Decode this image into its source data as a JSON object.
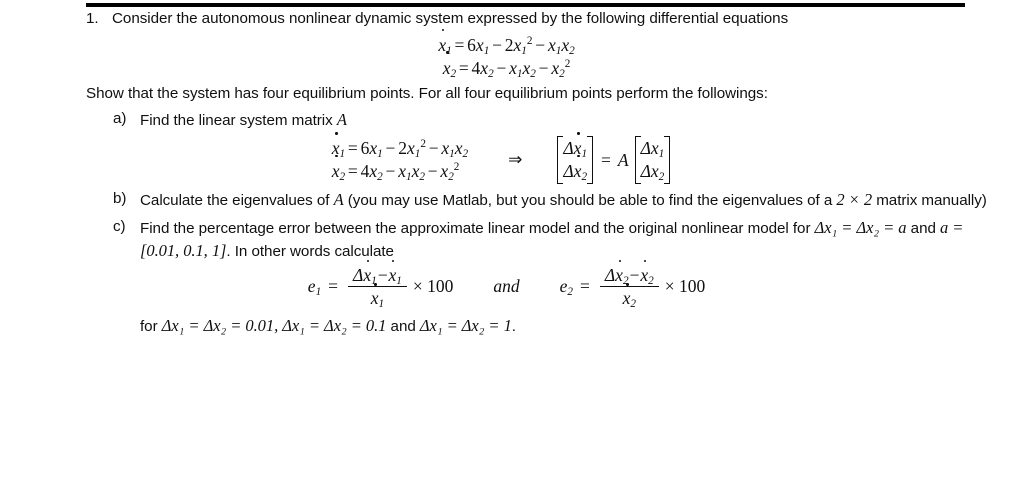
{
  "document": {
    "problem_number": "1.",
    "intro": "Consider the autonomous nonlinear dynamic system expressed by the following differential equations",
    "instruction": "Show that the system has four equilibrium points.  For all four equilibrium points perform the followings:",
    "system_equations": [
      {
        "lhs": "ẋ",
        "lhs_sub": "1",
        "rhs": "6x₁ − 2x₁² − x₁x₂"
      },
      {
        "lhs": "ẋ",
        "lhs_sub": "2",
        "rhs": "4x₂ − x₁x₂ − x₂²"
      }
    ],
    "parts": [
      {
        "marker": "a)",
        "text": "Find the linear system matrix ",
        "text_math": "A",
        "implies_symbol": "⇒",
        "matrix_lhs": [
          "Δẋ₁",
          "Δẋ₂"
        ],
        "matrix_equals": "=",
        "matrix_coeff": "A",
        "matrix_rhs": [
          "Δx₁",
          "Δx₂"
        ]
      },
      {
        "marker": "b)",
        "line1_pre": "Calculate the eigenvalues of ",
        "line1_math": "A",
        "line1_post": " (you may use Matlab, but you should be able to find the eigenvalues",
        "line2_pre": "of a ",
        "line2_math": "2 × 2",
        "line2_post": " matrix manually)"
      },
      {
        "marker": "c)",
        "line1": "Find the percentage error between the approximate linear model and the original nonlinear model",
        "line2_pre": "for ",
        "line2_math": "Δx₁ = Δx₂ = a",
        "line2_mid": " and ",
        "line2_math2": "a = [0.01, 0.1, 1]",
        "line2_post": ".  In other words calculate",
        "error_formulas": [
          {
            "name": "e",
            "name_sub": "1",
            "numerator": "Δẋ₁ − ẋ₁",
            "denominator": "ẋ₁",
            "multiplier": "× 100"
          },
          {
            "name": "e",
            "name_sub": "2",
            "numerator": "Δẋ₂ − ẋ₂",
            "denominator": "ẋ₂",
            "multiplier": "× 100"
          }
        ],
        "conjunction": "and",
        "closing_pre": "for ",
        "closing_math": "Δx₁ = Δx₂ = 0.01, Δx₁ = Δx₂ = 0.1",
        "closing_mid": " and ",
        "closing_math2": "Δx₁ = Δx₂ = 1",
        "closing_end": "."
      }
    ],
    "symbols": {
      "implies": "⇒",
      "delta": "Δ",
      "times": "×",
      "minus": "−",
      "equals": "="
    },
    "colors": {
      "text": "#101010",
      "background": "#ffffff",
      "rule": "#000000"
    }
  }
}
